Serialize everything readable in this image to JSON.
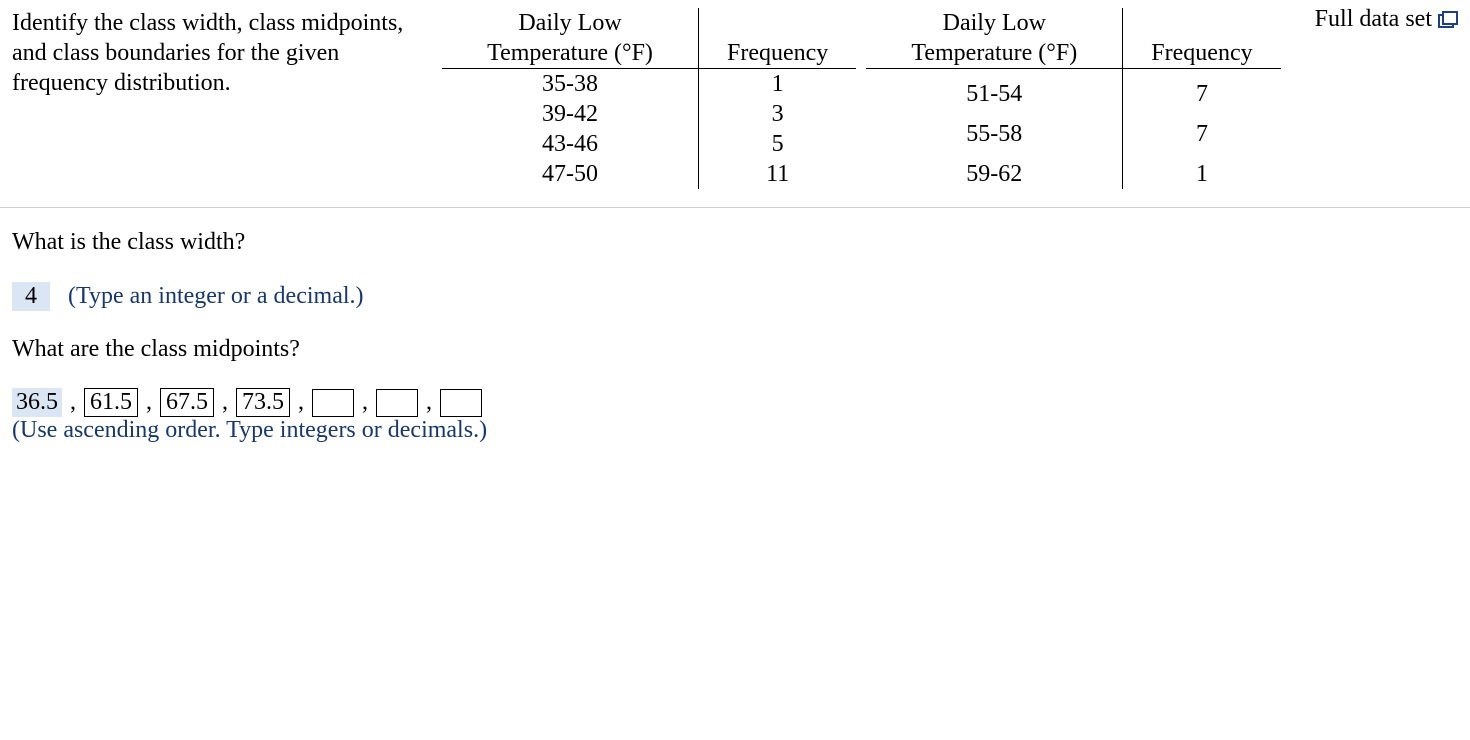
{
  "prompt": "Identify the class width, class midpoints, and class boundaries for the given frequency distribution.",
  "full_data_label": "Full data set",
  "headers": {
    "col1": "Daily Low Temperature (°F)",
    "col2": "Frequency"
  },
  "left_rows": [
    {
      "range": "35-38",
      "freq": "1"
    },
    {
      "range": "39-42",
      "freq": "3"
    },
    {
      "range": "43-46",
      "freq": "5"
    },
    {
      "range": "47-50",
      "freq": "11"
    }
  ],
  "right_rows": [
    {
      "range": "51-54",
      "freq": "7"
    },
    {
      "range": "55-58",
      "freq": "7"
    },
    {
      "range": "59-62",
      "freq": "1"
    }
  ],
  "q1": "What is the class width?",
  "q1_answer": "4",
  "q1_hint": "(Type an integer or a decimal.)",
  "q2": "What are the class midpoints?",
  "q2_answers": [
    "36.5",
    "61.5",
    "67.5",
    "73.5",
    "",
    "",
    ""
  ],
  "q2_hint": "(Use ascending order. Type integers or decimals.)",
  "sep": ","
}
